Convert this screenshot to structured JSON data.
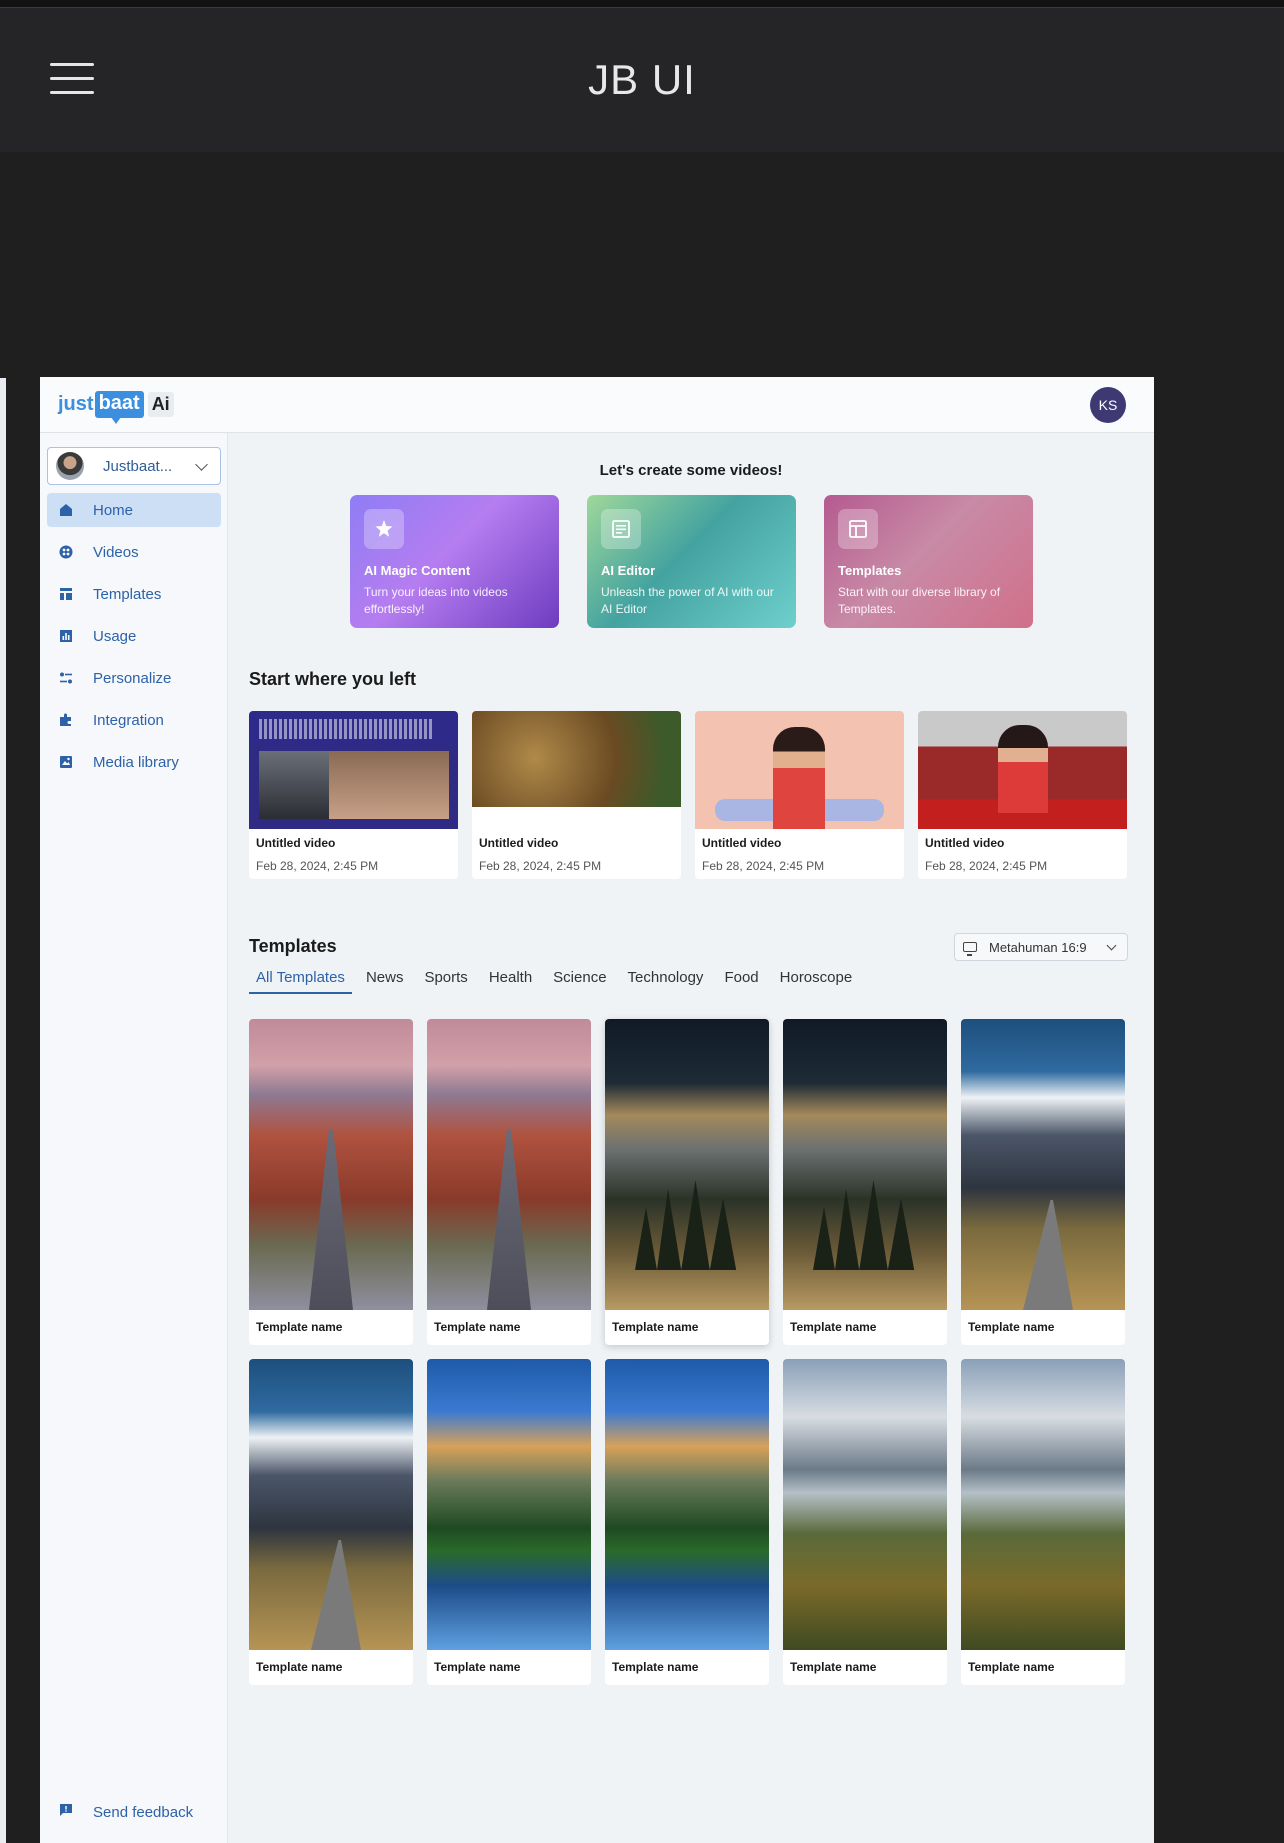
{
  "outer": {
    "title": "JB UI"
  },
  "app": {
    "logo": {
      "just": "just",
      "baat": "baat",
      "ai": "Ai"
    },
    "avatar_initials": "KS",
    "account": {
      "name": "Justbaat..."
    },
    "nav": [
      {
        "label": "Home",
        "icon": "home-icon",
        "active": true
      },
      {
        "label": "Videos",
        "icon": "videos-icon",
        "active": false
      },
      {
        "label": "Templates",
        "icon": "templates-icon",
        "active": false
      },
      {
        "label": "Usage",
        "icon": "usage-icon",
        "active": false
      },
      {
        "label": "Personalize",
        "icon": "personalize-icon",
        "active": false
      },
      {
        "label": "Integration",
        "icon": "integration-icon",
        "active": false
      },
      {
        "label": "Media library",
        "icon": "media-library-icon",
        "active": false
      }
    ],
    "feedback": "Send feedback",
    "hero": {
      "title": "Let's create some videos!",
      "cards": [
        {
          "title": "AI Magic Content",
          "desc": "Turn your ideas into videos effortlessly!"
        },
        {
          "title": "AI Editor",
          "desc": "Unleash the power of AI with our AI Editor"
        },
        {
          "title": "Templates",
          "desc": "Start with our diverse library of Templates."
        }
      ]
    },
    "recent": {
      "title": "Start where you left",
      "items": [
        {
          "name": "Untitled video",
          "date": "Feb 28, 2024, 2:45 PM"
        },
        {
          "name": "Untitled video",
          "date": "Feb 28, 2024, 2:45 PM"
        },
        {
          "name": "Untitled video",
          "date": "Feb 28, 2024, 2:45 PM"
        },
        {
          "name": "Untitled video",
          "date": "Feb 28, 2024, 2:45 PM"
        }
      ]
    },
    "templates": {
      "title": "Templates",
      "format_select": "Metahuman 16:9",
      "tabs": [
        "All Templates",
        "News",
        "Sports",
        "Health",
        "Science",
        "Technology",
        "Food",
        "Horoscope"
      ],
      "active_tab": "All Templates",
      "items": [
        "Template name",
        "Template name",
        "Template name",
        "Template name",
        "Template name",
        "Template name",
        "Template name",
        "Template name",
        "Template name",
        "Template name"
      ]
    }
  }
}
